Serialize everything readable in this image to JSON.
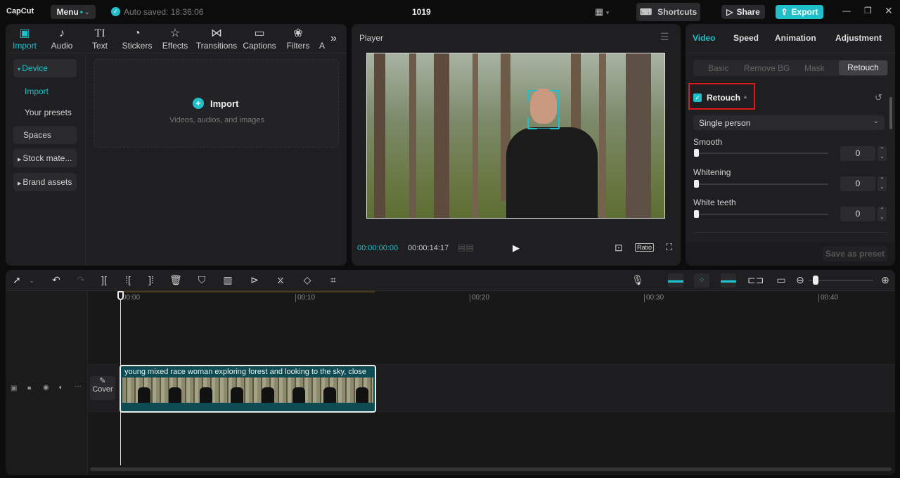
{
  "app": {
    "logo": "CapCut",
    "menu": "Menu",
    "autosave": "Auto saved: 18:36:06",
    "project_title": "1019",
    "shortcuts": "Shortcuts",
    "share": "Share",
    "export": "Export",
    "accent": "#1fc0c9"
  },
  "media_tabs": [
    {
      "label": "Import",
      "icon": "import-icon"
    },
    {
      "label": "Audio",
      "icon": "audio-icon"
    },
    {
      "label": "Text",
      "icon": "text-icon"
    },
    {
      "label": "Stickers",
      "icon": "stickers-icon"
    },
    {
      "label": "Effects",
      "icon": "effects-icon"
    },
    {
      "label": "Transitions",
      "icon": "transitions-icon"
    },
    {
      "label": "Captions",
      "icon": "captions-icon"
    },
    {
      "label": "Filters",
      "icon": "filters-icon"
    },
    {
      "label": "A",
      "icon": "adjust-icon"
    }
  ],
  "sidebar": {
    "device": "Device",
    "import": "Import",
    "presets": "Your presets",
    "spaces": "Spaces",
    "stock": "Stock mate...",
    "brand": "Brand assets"
  },
  "import_area": {
    "label": "Import",
    "hint": "Videos, audios, and images"
  },
  "player": {
    "title": "Player",
    "current_time": "00:00:00:00",
    "total_time": "00:00:14:17",
    "ratio": "Ratio"
  },
  "inspector": {
    "tabs": [
      "Video",
      "Speed",
      "Animation",
      "Adjustment"
    ],
    "subtabs": [
      "Basic",
      "Remove BG",
      "Mask",
      "Retouch"
    ],
    "section": "Retouch",
    "mode": "Single person",
    "sliders": [
      {
        "label": "Smooth",
        "value": "0"
      },
      {
        "label": "Whitening",
        "value": "0"
      },
      {
        "label": "White teeth",
        "value": "0"
      }
    ],
    "save_preset": "Save as preset"
  },
  "timeline": {
    "ticks": [
      "00:00",
      "00:10",
      "00:20",
      "00:30",
      "00:40"
    ],
    "cover": "Cover",
    "clip_title": "young mixed race woman exploring forest and looking to the sky, close"
  }
}
